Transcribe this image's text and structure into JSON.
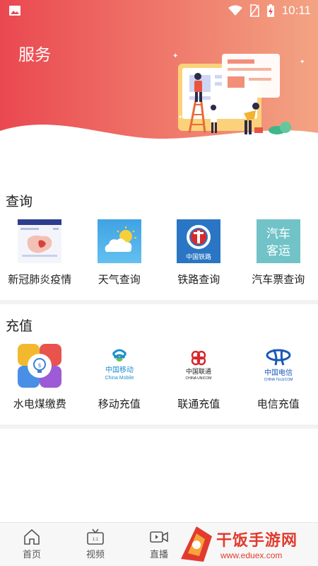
{
  "status_bar": {
    "time": "10:11",
    "icons": [
      "image-icon",
      "wifi-icon",
      "no-sim-icon",
      "battery-charging-icon"
    ]
  },
  "header": {
    "title": "服务",
    "colors": {
      "start": "#e9474f",
      "end": "#f2a080"
    }
  },
  "sections": [
    {
      "title": "查询",
      "items": [
        {
          "label": "新冠肺炎疫情",
          "icon": "epidemic-map-icon"
        },
        {
          "label": "天气查询",
          "icon": "weather-cloud-sun-icon"
        },
        {
          "label": "铁路查询",
          "icon": "china-railway-icon"
        },
        {
          "label": "汽车票查询",
          "icon": "bus-transport-icon"
        }
      ]
    },
    {
      "title": "充值",
      "items": [
        {
          "label": "水电煤缴费",
          "icon": "utility-bill-icon"
        },
        {
          "label": "移动充值",
          "icon": "china-mobile-logo-icon"
        },
        {
          "label": "联通充值",
          "icon": "china-unicom-logo-icon"
        },
        {
          "label": "电信充值",
          "icon": "china-telecom-logo-icon"
        }
      ]
    }
  ],
  "icon_texts": {
    "railway": "中国铁路",
    "bus_line1": "汽车",
    "bus_line2": "客运",
    "mobile_cn": "中国移动",
    "mobile_en": "China Mobile",
    "unicom_cn": "中国联通",
    "unicom_en": "CHINA UNICOM",
    "telecom_cn": "中国电信",
    "telecom_en": "CHINA TELECOM"
  },
  "bottom_nav": [
    {
      "label": "首页",
      "icon": "home-icon"
    },
    {
      "label": "视频",
      "icon": "tv-icon"
    },
    {
      "label": "直播",
      "icon": "video-camera-icon"
    }
  ],
  "watermark": {
    "text": "干饭手游网",
    "url": "www.eduex.com"
  }
}
